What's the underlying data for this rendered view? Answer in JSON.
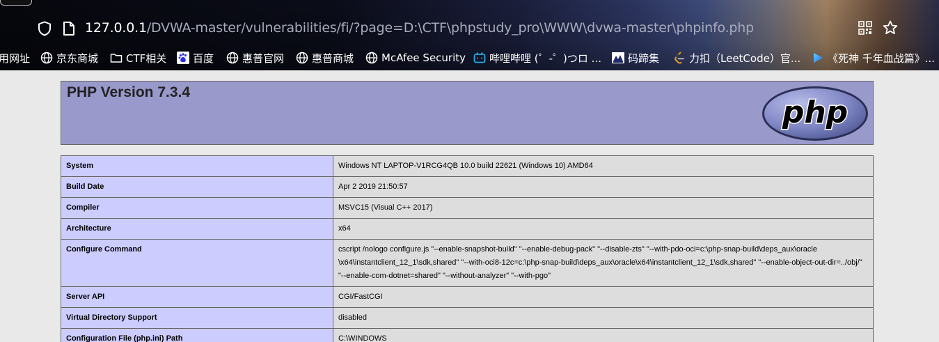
{
  "browser": {
    "url_host": "127.0.0.1",
    "url_path": "/DVWA-master/vulnerabilities/fi/?page=D:\\CTF\\phpstudy_pro\\WWW\\dvwa-master\\phpinfo.php",
    "icons": [
      "shield-icon",
      "page-icon",
      "qr-code-icon",
      "star-icon"
    ]
  },
  "bookmarks": [
    {
      "label": "用网址",
      "icon": "none"
    },
    {
      "label": "京东商城",
      "icon": "globe-icon"
    },
    {
      "label": "CTF相关",
      "icon": "folder-icon"
    },
    {
      "label": "百度",
      "icon": "baidu-icon"
    },
    {
      "label": "惠普官网",
      "icon": "globe-icon"
    },
    {
      "label": "惠普商城",
      "icon": "globe-icon"
    },
    {
      "label": "McAfee Security",
      "icon": "globe-icon"
    },
    {
      "label": "哔哩哔哩 (゜-゜)つロ ...",
      "icon": "bilibili-icon"
    },
    {
      "label": "码蹄集",
      "icon": "matiji-icon"
    },
    {
      "label": "力扣（LeetCode）官...",
      "icon": "leetcode-icon"
    },
    {
      "label": "《死神 千年血战篇》...",
      "icon": "video-icon"
    }
  ],
  "phpinfo": {
    "title": "PHP Version 7.3.4",
    "logo_text": "php",
    "colors": {
      "header": "#9999cc",
      "key_cell": "#ccccff",
      "value_cell": "#dddddd"
    },
    "rows": [
      {
        "key": "System",
        "value": "Windows NT LAPTOP-V1RCG4QB 10.0 build 22621 (Windows 10) AMD64"
      },
      {
        "key": "Build Date",
        "value": "Apr 2 2019 21:50:57"
      },
      {
        "key": "Compiler",
        "value": "MSVC15 (Visual C++ 2017)"
      },
      {
        "key": "Architecture",
        "value": "x64"
      },
      {
        "key": "Configure Command",
        "lines": [
          "cscript /nologo configure.js \"--enable-snapshot-build\" \"--enable-debug-pack\" \"--disable-zts\" \"--with-pdo-oci=c:\\php-snap-build\\deps_aux\\oracle",
          "\\x64\\instantclient_12_1\\sdk,shared\" \"--with-oci8-12c=c:\\php-snap-build\\deps_aux\\oracle\\x64\\instantclient_12_1\\sdk,shared\" \"--enable-object-out-dir=../obj/\"",
          "\"--enable-com-dotnet=shared\" \"--without-analyzer\" \"--with-pgo\""
        ]
      },
      {
        "key": "Server API",
        "value": "CGI/FastCGI"
      },
      {
        "key": "Virtual Directory Support",
        "value": "disabled"
      },
      {
        "key": "Configuration File (php.ini) Path",
        "value": "C:\\WINDOWS"
      }
    ]
  }
}
